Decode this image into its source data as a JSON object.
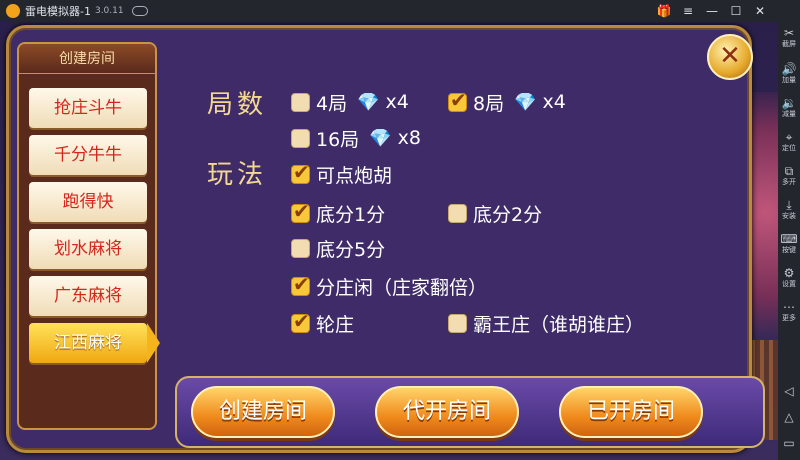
{
  "titlebar": {
    "title": "雷电模拟器-1",
    "version": "3.0.11",
    "gift_icon": "gift-icon",
    "menu_glyph": "≡",
    "min_glyph": "—",
    "max_glyph": "☐",
    "close_glyph": "✕"
  },
  "sidebar": {
    "items": [
      {
        "icon": "✂",
        "label": "截屏"
      },
      {
        "icon": "🔊",
        "label": "加量"
      },
      {
        "icon": "🔉",
        "label": "减量"
      },
      {
        "icon": "⌖",
        "label": "定位"
      },
      {
        "icon": "⧉",
        "label": "多开"
      },
      {
        "icon": "⤓",
        "label": "安装"
      },
      {
        "icon": "⌨",
        "label": "按键"
      },
      {
        "icon": "⚙",
        "label": "设置"
      },
      {
        "icon": "⋯",
        "label": "更多"
      }
    ],
    "nav": {
      "back": "◁",
      "home": "△",
      "recent": "▭"
    }
  },
  "dialog": {
    "tab_column_title": "创建房间",
    "tabs": [
      {
        "label": "抢庄斗牛",
        "active": false
      },
      {
        "label": "千分牛牛",
        "active": false
      },
      {
        "label": "跑得快",
        "active": false
      },
      {
        "label": "划水麻将",
        "active": false
      },
      {
        "label": "广东麻将",
        "active": false
      },
      {
        "label": "江西麻将",
        "active": true
      }
    ],
    "close_glyph": "✕",
    "rounds_label": "局数",
    "rules_label": "玩法",
    "round_options": [
      {
        "label": "4局",
        "cost": "x4",
        "checked": false
      },
      {
        "label": "8局",
        "cost": "x4",
        "checked": true
      },
      {
        "label": "16局",
        "cost": "x8",
        "checked": false
      }
    ],
    "gem_glyph": "💎",
    "rule_options": [
      {
        "label": "可点炮胡",
        "checked": true
      },
      {
        "label": "底分1分",
        "checked": true
      },
      {
        "label": "底分2分",
        "checked": false
      },
      {
        "label": "底分5分",
        "checked": false
      },
      {
        "label": "分庄闲（庄家翻倍）",
        "checked": true
      },
      {
        "label": "轮庄",
        "checked": true
      },
      {
        "label": "霸王庄（谁胡谁庄）",
        "checked": false
      }
    ],
    "buttons": {
      "create": "创建房间",
      "proxy": "代开房间",
      "opened": "已开房间"
    }
  }
}
